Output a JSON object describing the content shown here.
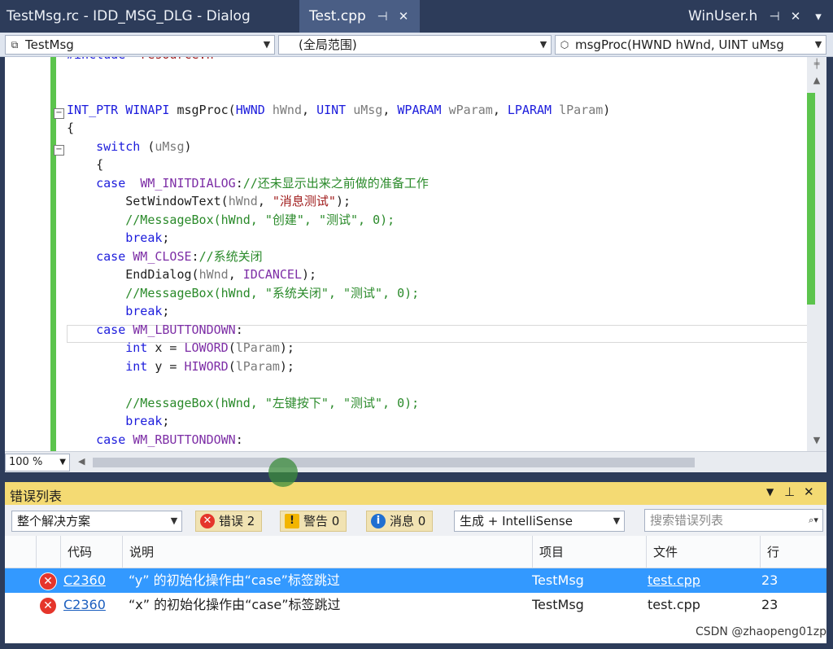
{
  "tabs": {
    "rc_tab": "TestMsg.rc - IDD_MSG_DLG - Dialog",
    "cpp_tab": "Test.cpp",
    "winuser_tab": "WinUser.h",
    "pin": "⊣",
    "close": "✕"
  },
  "navbar": {
    "project": "TestMsg",
    "scope": "(全局范围)",
    "member": "msgProc(HWND hWnd, UINT uMsg"
  },
  "code_lines": [
    "#include \"resource.h\"",
    "",
    "",
    "INT_PTR WINAPI msgProc(HWND hWnd, UINT uMsg, WPARAM wParam, LPARAM lParam)",
    "{",
    "    switch (uMsg)",
    "    {",
    "    case  WM_INITDIALOG://还未显示出来之前做的准备工作",
    "        SetWindowText(hWnd, \"消息测试\");",
    "        //MessageBox(hWnd, \"创建\", \"测试\", 0);",
    "        break;",
    "    case WM_CLOSE://系统关闭",
    "        EndDialog(hWnd, IDCANCEL);",
    "        //MessageBox(hWnd, \"系统关闭\", \"测试\", 0);",
    "        break;",
    "    case WM_LBUTTONDOWN:",
    "        int x = LOWORD(lParam);",
    "        int y = HIWORD(lParam);",
    "",
    "        //MessageBox(hWnd, \"左键按下\", \"测试\", 0);",
    "        break;",
    "    case WM_RBUTTONDOWN:"
  ],
  "zoom": "100 %",
  "error_list": {
    "title": "错误列表",
    "scope": "整个解决方案",
    "errors_btn": "错误 2",
    "warnings_btn": "警告 0",
    "messages_btn": "消息 0",
    "build_filter": "生成 + IntelliSense",
    "search_placeholder": "搜索错误列表",
    "columns": {
      "code": "代码",
      "desc": "说明",
      "project": "项目",
      "file": "文件",
      "line": "行"
    },
    "rows": [
      {
        "code": "C2360",
        "desc": "“y” 的初始化操作由“case”标签跳过",
        "project": "TestMsg",
        "file": "test.cpp",
        "line": "23"
      },
      {
        "code": "C2360",
        "desc": "“x” 的初始化操作由“case”标签跳过",
        "project": "TestMsg",
        "file": "test.cpp",
        "line": "23"
      }
    ]
  },
  "watermark": "CSDN @zhaopeng01zp"
}
